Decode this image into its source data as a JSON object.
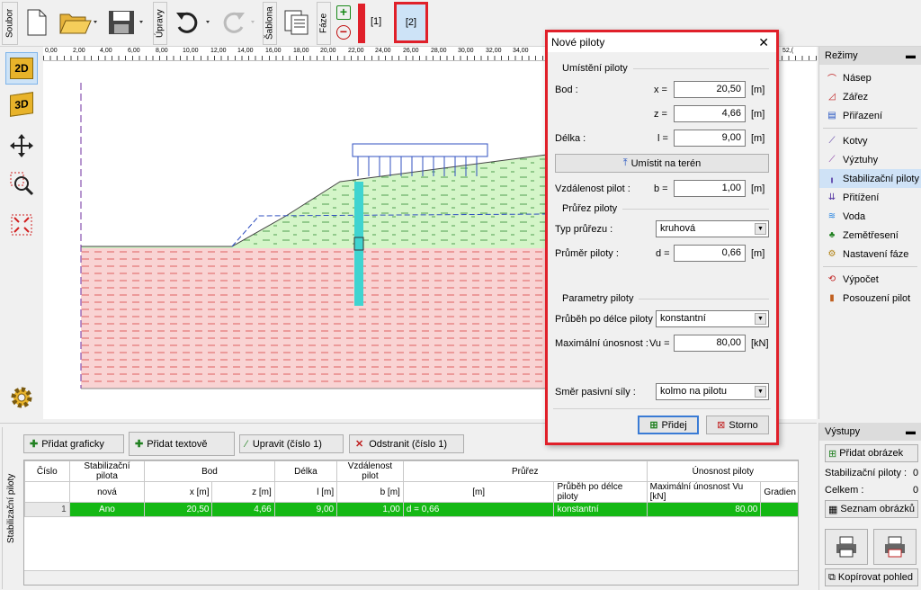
{
  "toolbar": {
    "soubor": "Soubor",
    "upravy": "Úpravy",
    "sablona": "Šablona",
    "faze": "Fáze",
    "stage1": "[1]",
    "stage2": "[2]"
  },
  "ruler": {
    "ticks": [
      "0,00",
      "2,00",
      "4,00",
      "6,00",
      "8,00",
      "10,00",
      "12,00",
      "14,00",
      "16,00",
      "18,00",
      "20,00",
      "22,00",
      "24,00",
      "26,00",
      "28,00",
      "30,00",
      "32,00",
      "34,00"
    ],
    "right_tick": "52,("
  },
  "left_toolbar": {
    "b2d": "2D",
    "b3d": "3D"
  },
  "modes": {
    "title": "Režimy",
    "items": [
      {
        "label": "Násep",
        "icon": "embankment-icon"
      },
      {
        "label": "Zářez",
        "icon": "cut-icon"
      },
      {
        "label": "Přiřazení",
        "icon": "assign-icon"
      },
      {
        "label": "Kotvy",
        "icon": "anchors-icon"
      },
      {
        "label": "Výztuhy",
        "icon": "reinforcement-icon"
      },
      {
        "label": "Stabilizační piloty",
        "icon": "piles-icon"
      },
      {
        "label": "Přitížení",
        "icon": "surcharge-icon"
      },
      {
        "label": "Voda",
        "icon": "water-icon"
      },
      {
        "label": "Zemětřesení",
        "icon": "earthquake-icon"
      },
      {
        "label": "Nastavení fáze",
        "icon": "stage-settings-icon"
      },
      {
        "label": "Výpočet",
        "icon": "calculation-icon"
      },
      {
        "label": "Posouzení pilot",
        "icon": "pile-check-icon"
      }
    ]
  },
  "outputs": {
    "title": "Výstupy",
    "add_image": "Přidat obrázek",
    "stab_piles_label": "Stabilizační piloty :",
    "stab_piles_count": "0",
    "total_label": "Celkem :",
    "total_count": "0",
    "image_list": "Seznam obrázků",
    "copy_view": "Kopírovat pohled"
  },
  "bottom": {
    "side_label": "Stabilizační piloty",
    "add_graphic": "Přidat graficky",
    "add_text": "Přidat textově",
    "edit": "Upravit (číslo 1)",
    "remove": "Odstranit (číslo 1)",
    "headers1": [
      "Číslo",
      "Stabilizační pilota",
      "Bod",
      "",
      "Délka",
      "Vzdálenost pilot",
      "Průřez",
      "",
      "Únosnost piloty",
      ""
    ],
    "headers2": [
      "",
      "nová",
      "x [m]",
      "z [m]",
      "l [m]",
      "b [m]",
      "[m]",
      "Průběh po délce piloty",
      "Maximální únosnost Vu [kN]",
      "Gradien"
    ],
    "row": [
      "1",
      "Ano",
      "20,50",
      "4,66",
      "9,00",
      "1,00",
      "d = 0,66",
      "konstantní",
      "80,00",
      ""
    ]
  },
  "dialog": {
    "title": "Nové piloty",
    "sec_location": "Umístění piloty",
    "bod": "Bod :",
    "x_sym": "x =",
    "x_val": "20,50",
    "z_sym": "z =",
    "z_val": "4,66",
    "delka": "Délka :",
    "l_sym": "l =",
    "l_val": "9,00",
    "unit_m": "[m]",
    "place_on_terrain": "Umístit na terén",
    "spacing": "Vzdálenost pilot :",
    "b_sym": "b =",
    "b_val": "1,00",
    "sec_section": "Průřez piloty",
    "section_type": "Typ průřezu :",
    "section_type_val": "kruhová",
    "diameter": "Průměr piloty :",
    "d_sym": "d =",
    "d_val": "0,66",
    "sec_params": "Parametry piloty",
    "course": "Průběh po délce piloty :",
    "course_val": "konstantní",
    "max_cap": "Maximální únosnost :",
    "vu_sym": "Vu =",
    "vu_val": "80,00",
    "unit_kn": "[kN]",
    "passive_dir": "Směr pasivní síly :",
    "passive_dir_val": "kolmo na pilotu",
    "add": "Přidej",
    "cancel": "Storno"
  },
  "colors": {
    "highlight": "#e0202a",
    "row_green": "#14b814",
    "soil_green": "#d4f5c8",
    "soil_red": "#f9d3d3",
    "pile": "#3fd4d0"
  }
}
